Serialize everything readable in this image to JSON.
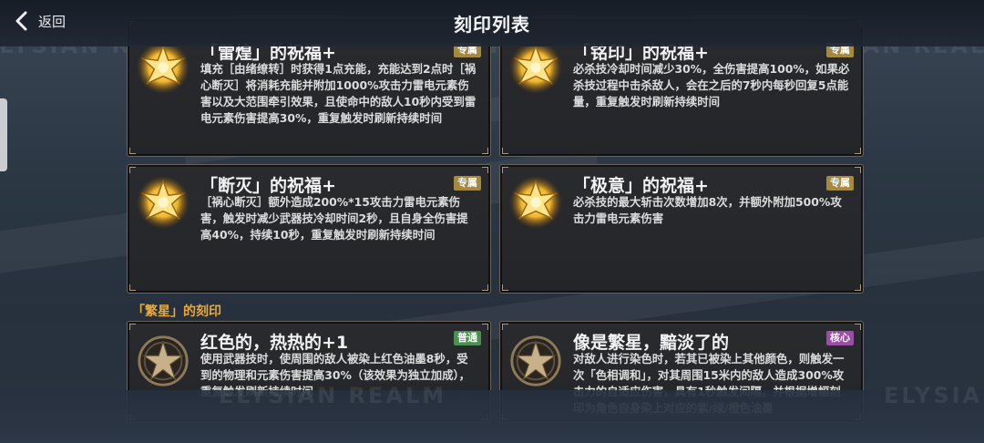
{
  "header": {
    "back_label": "返回",
    "title": "刻印列表"
  },
  "watermark_text": "ELYSIAN REALM",
  "section": {
    "label": "「繁星」的刻印"
  },
  "cards": [
    {
      "title": "「雷煌」的祝福+",
      "badge": "专属",
      "badge_type": "excl",
      "emblem": "gold-lotus-emblem-icon",
      "desc": "填充［由绪缭转］时获得1点充能，充能达到2点时［祸心断灭］将消耗充能并附加1000%攻击力雷电元素伤害以及大范围牵引效果，且使命中的敌人10秒内受到雷电元素伤害提高30%，重复触发时刷新持续时间"
    },
    {
      "title": "「铭印」的祝福+",
      "badge": "专属",
      "badge_type": "excl",
      "emblem": "gold-lotus-emblem-icon",
      "desc": "必杀技冷却时间减少30%，全伤害提高100%，如果必杀技过程中击杀敌人，会在之后的7秒内每秒回复5点能量，重复触发时刷新持续时间"
    },
    {
      "title": "「断灭」的祝福+",
      "badge": "专属",
      "badge_type": "excl",
      "emblem": "gold-lotus-emblem-icon",
      "desc": "［祸心断灭］额外造成200%*15攻击力雷电元素伤害，触发时减少武器技冷却时间2秒，且自身全伤害提高40%，持续10秒，重复触发时刷新持续时间"
    },
    {
      "title": "「极意」的祝福+",
      "badge": "专属",
      "badge_type": "excl",
      "emblem": "gold-lotus-emblem-icon",
      "desc": "必杀技的最大斩击次数增加8次，并额外附加500%攻击力雷电元素伤害"
    },
    {
      "title": "红色的，热热的+1",
      "badge": "普通",
      "badge_type": "normal",
      "emblem": "star-ring-emblem-icon",
      "desc": "使用武器技时，使周围的敌人被染上红色油墨8秒，受到的物理和元素伤害提高30%（该效果为独立加成），重复触发刷新持续时间"
    },
    {
      "title": "像是繁星，黯淡了的",
      "badge": "核心",
      "badge_type": "core",
      "emblem": "star-ring-emblem-icon",
      "desc": "对敌人进行染色时，若其已被染上其他颜色，则触发一次「色相调和」，对其周围15米内的敌人造成300%攻击力的自适应伤害，具有1秒触发间隔，并根据增幅刻印为角色自身染上对应的紫/绿/橙色油墨"
    }
  ]
}
